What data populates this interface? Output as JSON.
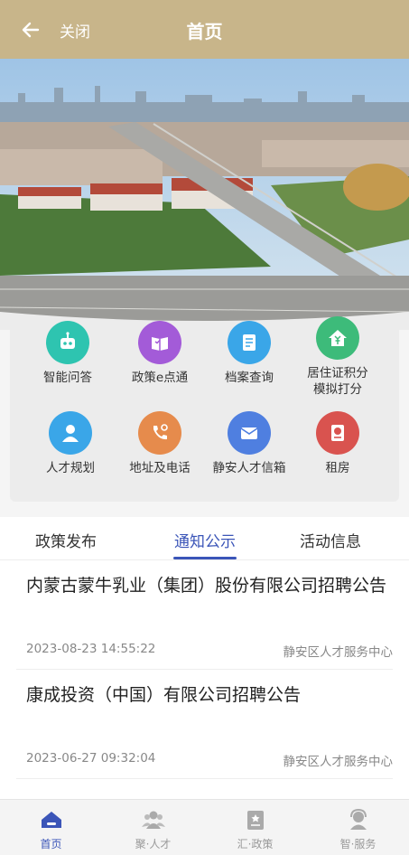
{
  "header": {
    "back_label": "关闭",
    "title": "首页"
  },
  "services": [
    {
      "label": "智能问答",
      "icon": "robot-icon",
      "color": "#2ec4b0"
    },
    {
      "label": "政策e点通",
      "icon": "policy-book-icon",
      "color": "#a35bd8"
    },
    {
      "label": "档案查询",
      "icon": "archive-icon",
      "color": "#3aa6e8"
    },
    {
      "label": "居住证积分\n模拟打分",
      "icon": "residence-points-icon",
      "color": "#3dbb7a"
    },
    {
      "label": "人才规划",
      "icon": "person-icon",
      "color": "#3aa6e8"
    },
    {
      "label": "地址及电话",
      "icon": "phone-location-icon",
      "color": "#e68b4c"
    },
    {
      "label": "静安人才信箱",
      "icon": "mailbox-icon",
      "color": "#4f7fe0"
    },
    {
      "label": "租房",
      "icon": "house-rental-icon",
      "color": "#d9534f"
    }
  ],
  "tabs": [
    {
      "label": "政策发布"
    },
    {
      "label": "通知公示"
    },
    {
      "label": "活动信息"
    }
  ],
  "news": [
    {
      "title": "内蒙古蒙牛乳业（集团）股份有限公司招聘公告",
      "date": "2023-08-23 14:55:22",
      "source": "静安区人才服务中心"
    },
    {
      "title": "康成投资（中国）有限公司招聘公告",
      "date": "2023-06-27 09:32:04",
      "source": "静安区人才服务中心"
    }
  ],
  "nav": [
    {
      "label": "首页",
      "icon": "home-icon"
    },
    {
      "label": "聚·人才",
      "icon": "people-icon"
    },
    {
      "label": "汇·政策",
      "icon": "policy-icon"
    },
    {
      "label": "智·服务",
      "icon": "service-agent-icon"
    }
  ],
  "colors": {
    "header": "#c8b58a",
    "accent": "#3b55b8"
  }
}
